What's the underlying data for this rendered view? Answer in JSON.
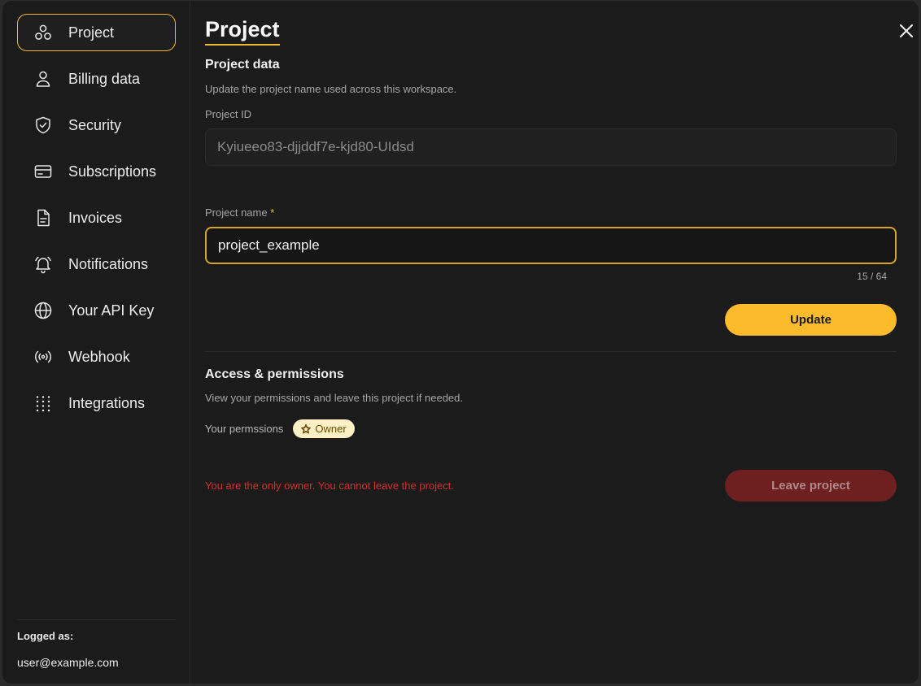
{
  "sidebar": {
    "items": [
      {
        "label": "Project",
        "icon": "circles-icon",
        "active": true
      },
      {
        "label": "Billing data",
        "icon": "user-icon"
      },
      {
        "label": "Security",
        "icon": "shield-check-icon"
      },
      {
        "label": "Subscriptions",
        "icon": "credit-card-icon"
      },
      {
        "label": "Invoices",
        "icon": "document-icon"
      },
      {
        "label": "Notifications",
        "icon": "bell-icon"
      },
      {
        "label": "Your API Key",
        "icon": "globe-icon"
      },
      {
        "label": "Webhook",
        "icon": "broadcast-icon"
      },
      {
        "label": "Integrations",
        "icon": "grid-dots-icon"
      }
    ],
    "logged_as_label": "Logged as:",
    "logged_email": "user@example.com"
  },
  "main": {
    "title": "Project",
    "project_data": {
      "title": "Project data",
      "description": "Update the project name used across this workspace.",
      "project_id_label": "Project ID",
      "project_id_value": "Kyiueeo83-djjddf7e-kjd80-UIdsd",
      "project_name_label": "Project name",
      "required_mark": "*",
      "project_name_value": "project_example",
      "counter": "15 / 64",
      "update_label": "Update"
    },
    "access": {
      "title": "Access & permissions",
      "description": "View your permissions and leave this project if needed.",
      "permissions_label": "Your permssions",
      "badge_label": "Owner",
      "error_text": "You are the only owner. You cannot leave the project.",
      "leave_label": "Leave project"
    }
  },
  "colors": {
    "accent": "#fbbb2b",
    "background": "#1b1b1b",
    "error": "#d32f2f",
    "leave_button": "#6e1f1f"
  }
}
